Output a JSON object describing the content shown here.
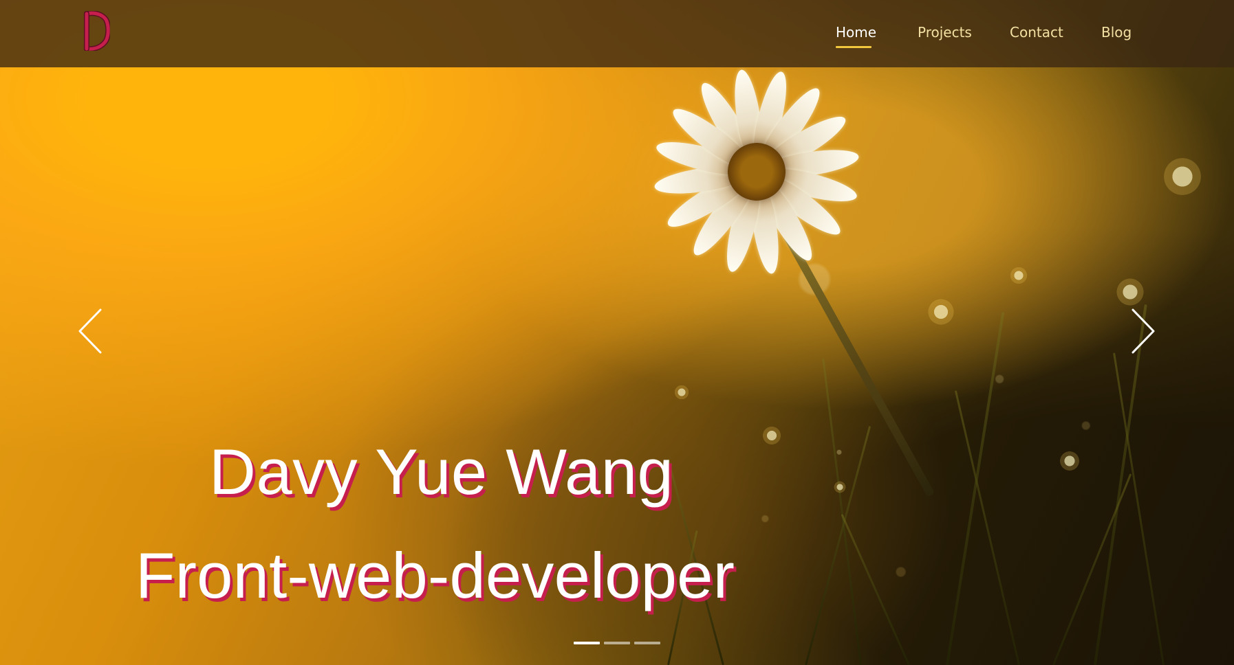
{
  "site": {
    "logo": {
      "letter": "D",
      "accent": "#c61f4d"
    },
    "nav": {
      "items": [
        {
          "label": "Home",
          "active": true
        },
        {
          "label": "Projects",
          "active": false
        },
        {
          "label": "Contact",
          "active": false
        },
        {
          "label": "Blog",
          "active": false
        }
      ]
    }
  },
  "hero": {
    "title": "Davy Yue Wang",
    "subtitle": "Front-web-developer",
    "slides": {
      "active_index": 0,
      "count": 3
    },
    "controls": {
      "previous_icon": "chevron-left-icon",
      "next_icon": "chevron-right-icon"
    }
  },
  "colors": {
    "header_background": "#3a2612",
    "nav_text": "#f3e1a4",
    "nav_active_text": "#ffffff",
    "nav_underline": "#f3c73d",
    "title_shadow": "#c61f4d"
  }
}
